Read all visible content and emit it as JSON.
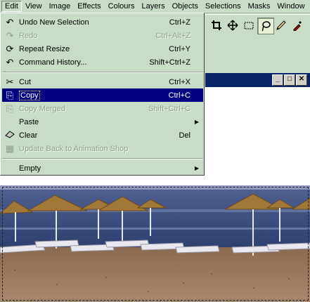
{
  "menubar": {
    "items": [
      "Edit",
      "View",
      "Image",
      "Effects",
      "Colours",
      "Layers",
      "Objects",
      "Selections",
      "Masks",
      "Window"
    ]
  },
  "toolbar": {
    "tools": [
      "crop-icon",
      "move-icon",
      "selection-icon",
      "freehand-icon",
      "pen-icon",
      "dropper-icon"
    ],
    "pressed": "freehand-icon"
  },
  "edit_menu": {
    "items": [
      {
        "label": "Undo New Selection",
        "shortcut": "Ctrl+Z",
        "icon": "undo-icon",
        "enabled": true
      },
      {
        "label": "Redo",
        "shortcut": "Ctrl+Alt+Z",
        "icon": "redo-icon",
        "enabled": false
      },
      {
        "label": "Repeat Resize",
        "shortcut": "Ctrl+Y",
        "icon": "repeat-icon",
        "enabled": true
      },
      {
        "label": "Command History...",
        "shortcut": "Shift+Ctrl+Z",
        "icon": "history-icon",
        "enabled": true
      },
      {
        "label": "Cut",
        "shortcut": "Ctrl+X",
        "icon": "scissors-icon",
        "enabled": true
      },
      {
        "label": "Copy",
        "shortcut": "Ctrl+C",
        "icon": "copy-icon",
        "enabled": true,
        "highlighted": true
      },
      {
        "label": "Copy Merged",
        "shortcut": "Shift+Ctrl+C",
        "icon": "copy-merged-icon",
        "enabled": false
      },
      {
        "label": "Paste",
        "shortcut": "",
        "icon": "",
        "enabled": true,
        "submenu": true
      },
      {
        "label": "Clear",
        "shortcut": "Del",
        "icon": "eraser-icon",
        "enabled": true
      },
      {
        "label": "Update Back to Animation Shop",
        "shortcut": "",
        "icon": "animation-shop-icon",
        "enabled": false
      },
      {
        "label": "Empty",
        "shortcut": "",
        "icon": "",
        "enabled": true,
        "submenu": true
      }
    ]
  },
  "colors": {
    "menu_bg": "#c8dcc8",
    "highlight": "#000080",
    "titlebar": "#0a246a"
  }
}
